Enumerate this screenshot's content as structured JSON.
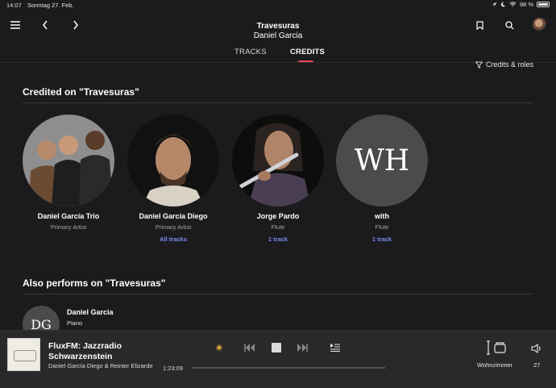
{
  "status": {
    "time": "14:07",
    "date": "Sonntag 27. Feb.",
    "battery": "98 %"
  },
  "header": {
    "album_title": "Travesuras",
    "album_artist": "Daniel Garcia",
    "tabs": [
      {
        "label": "TRACKS"
      },
      {
        "label": "CREDITS"
      }
    ],
    "active_tab": "CREDITS"
  },
  "filter": {
    "label": "Credits & roles"
  },
  "credited": {
    "title": "Credited on \"Travesuras\"",
    "items": [
      {
        "name": "Daniel García Trio",
        "role": "Primary Artist",
        "link": ""
      },
      {
        "name": "Daniel García Diego",
        "role": "Primary Artist",
        "link": "All tracks"
      },
      {
        "name": "Jorge Pardo",
        "role": "Flute",
        "link": "1 track"
      },
      {
        "name": "with",
        "role": "Flute",
        "link": "1 track",
        "initials": "WH"
      }
    ]
  },
  "also": {
    "title": "Also performs on \"Travesuras\"",
    "items": [
      {
        "initials": "DG",
        "name": "Daniel Garcia",
        "role": "Piano"
      }
    ]
  },
  "player": {
    "title": "FluxFM: Jazzradio Schwarzenstein",
    "subtitle": "Daniel García Diego & Reinier Elizarde",
    "elapsed": "1:23:09",
    "room": "Wohnzimmer",
    "volume": "27",
    "accent": "#e4475d",
    "link_color": "#7b8cf5"
  }
}
